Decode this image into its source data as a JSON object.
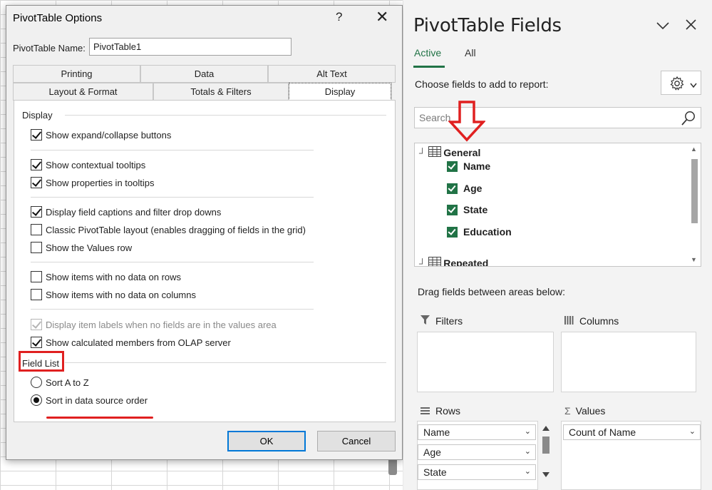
{
  "dialog": {
    "title": "PivotTable Options",
    "help_icon": "?",
    "close_icon": "✕",
    "name_label": "PivotTable Name:",
    "name_value": "PivotTable1",
    "tabs_row1": [
      "Printing",
      "Data",
      "Alt Text"
    ],
    "tabs_row2": [
      "Layout & Format",
      "Totals & Filters",
      "Display"
    ],
    "active_tab": "Display",
    "display_section": "Display",
    "options": [
      {
        "label": "Show expand/collapse buttons",
        "checked": true,
        "enabled": true
      },
      {
        "label": "Show contextual tooltips",
        "checked": true,
        "enabled": true
      },
      {
        "label": "Show properties in tooltips",
        "checked": true,
        "enabled": true
      },
      {
        "label": "Display field captions and filter drop downs",
        "checked": true,
        "enabled": true
      },
      {
        "label": "Classic PivotTable layout (enables dragging of fields in the grid)",
        "checked": false,
        "enabled": true
      },
      {
        "label": "Show the Values row",
        "checked": false,
        "enabled": true
      },
      {
        "label": "Show items with no data on rows",
        "checked": false,
        "enabled": true
      },
      {
        "label": "Show items with no data on columns",
        "checked": false,
        "enabled": true
      },
      {
        "label": "Display item labels when no fields are in the values area",
        "checked": true,
        "enabled": false
      },
      {
        "label": "Show calculated members from OLAP server",
        "checked": true,
        "enabled": true
      }
    ],
    "field_list_section": "Field List",
    "sort_options": [
      {
        "label": "Sort A to Z",
        "selected": false
      },
      {
        "label": "Sort in data source order",
        "selected": true
      }
    ],
    "ok_label": "OK",
    "cancel_label": "Cancel"
  },
  "pane": {
    "title": "PivotTable Fields",
    "tabs": [
      "Active",
      "All"
    ],
    "active_tab": "Active",
    "choose_label": "Choose fields to add to report:",
    "search_placeholder": "Search",
    "groups": [
      {
        "name": "General",
        "fields": [
          "Name",
          "Age",
          "State",
          "Education"
        ]
      },
      {
        "name": "Repeated",
        "fields": []
      }
    ],
    "drag_label": "Drag fields between areas below:",
    "areas": {
      "filters": {
        "label": "Filters",
        "items": []
      },
      "columns": {
        "label": "Columns",
        "items": []
      },
      "rows": {
        "label": "Rows",
        "items": [
          "Name",
          "Age",
          "State"
        ]
      },
      "values": {
        "label": "Values",
        "items": [
          "Count of Name"
        ]
      }
    }
  },
  "colors": {
    "accent_green": "#217346",
    "annotation_red": "#e02020",
    "ok_border": "#0078d7"
  }
}
